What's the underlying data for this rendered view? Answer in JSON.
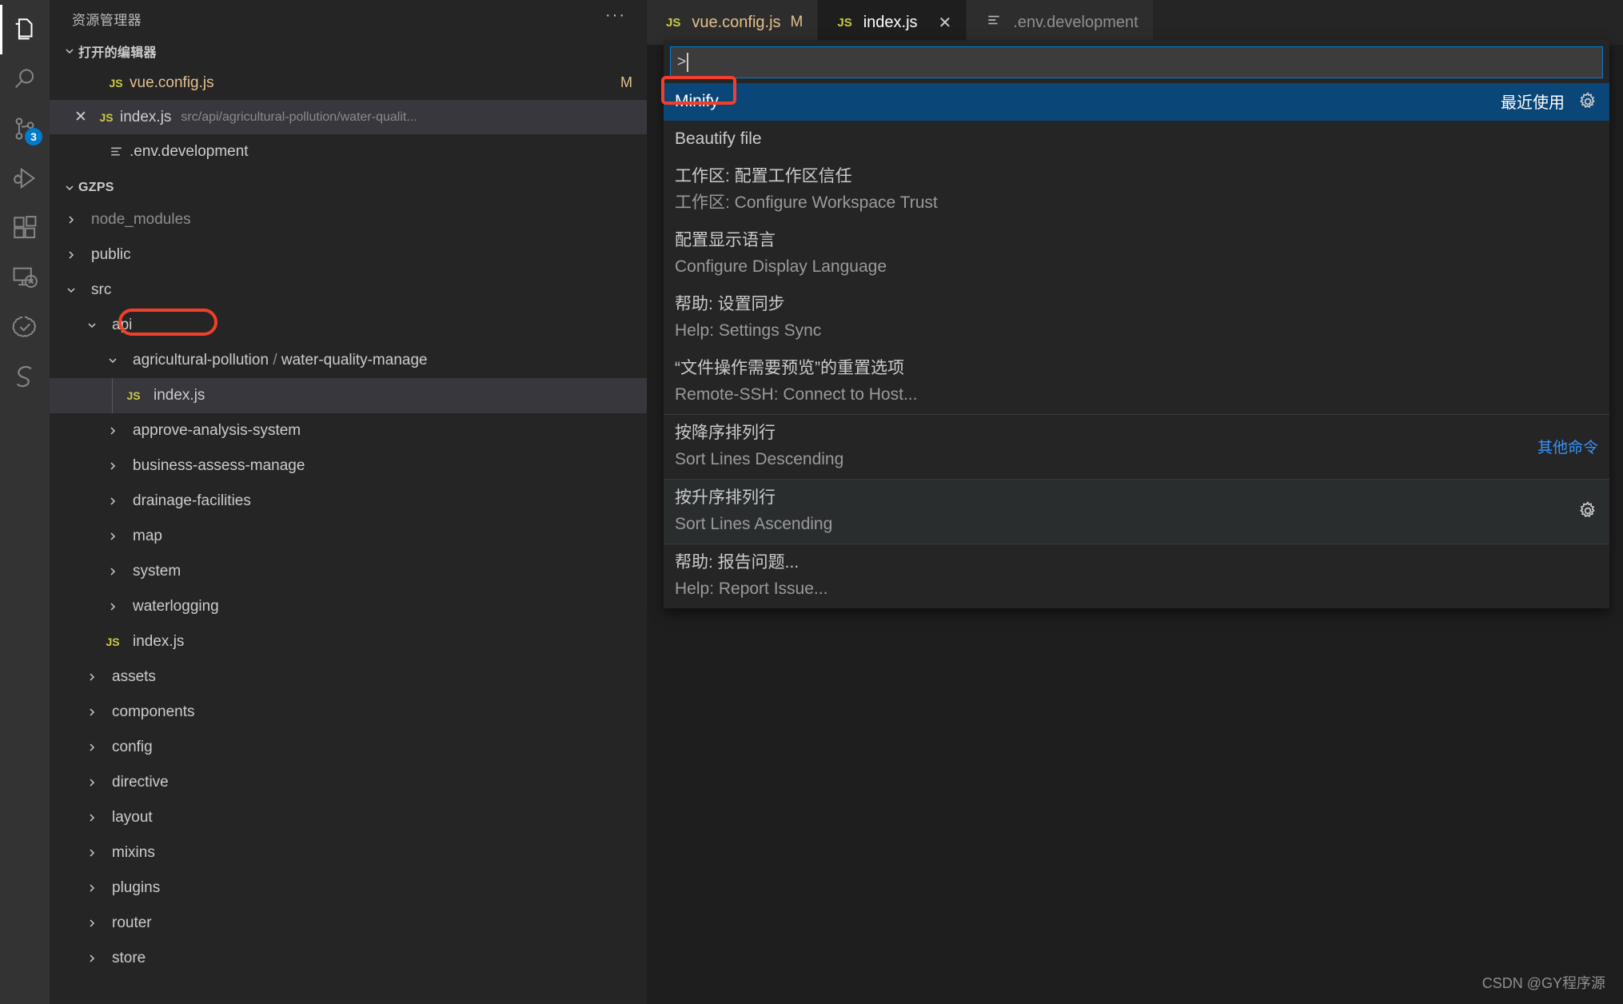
{
  "colors": {
    "activity_bar_bg": "#333333",
    "sidebar_bg": "#252526",
    "editor_bg": "#1e1e1e",
    "tab_active_bg": "#1e1e1e",
    "tab_inactive_bg": "#2d2d2d",
    "selected_row_bg": "#0b4678",
    "hover_row_bg": "#2a2d2e",
    "focus_border": "#007fd4",
    "badge_blue": "#007acc",
    "annotation_red": "#f0402a",
    "group_label_blue": "#3794ff",
    "modified_orange": "#e2c08d",
    "js_icon_yellow": "#cbcb41"
  },
  "activity_bar": {
    "items": [
      {
        "name": "explorer",
        "icon": "files-icon",
        "active": true,
        "badge": ""
      },
      {
        "name": "search",
        "icon": "search-icon",
        "active": false,
        "badge": ""
      },
      {
        "name": "source-control",
        "icon": "source-control-icon",
        "active": false,
        "badge": "3"
      },
      {
        "name": "run-and-debug",
        "icon": "run-debug-icon",
        "active": false,
        "badge": ""
      },
      {
        "name": "extensions",
        "icon": "extensions-icon",
        "active": false,
        "badge": ""
      },
      {
        "name": "remote-explorer",
        "icon": "remote-explorer-icon",
        "active": false,
        "badge": ""
      },
      {
        "name": "testing",
        "icon": "check-cloud-icon",
        "active": false,
        "badge": ""
      },
      {
        "name": "settings-sync",
        "icon": "s-logo-icon",
        "active": false,
        "badge": ""
      }
    ]
  },
  "sidebar": {
    "title": "资源管理器",
    "actions_label": "···",
    "open_editors": {
      "header": "打开的编辑器",
      "items": [
        {
          "icon": "js",
          "name": "vue.config.js",
          "path": "",
          "modified_badge": "M",
          "close_visible": false,
          "selected": false
        },
        {
          "icon": "js",
          "name": "index.js",
          "path": "src/api/agricultural-pollution/water-qualit...",
          "modified_badge": "",
          "close_visible": true,
          "selected": true
        },
        {
          "icon": "cfg",
          "name": ".env.development",
          "path": "",
          "modified_badge": "",
          "close_visible": false,
          "selected": false
        }
      ]
    },
    "project": {
      "header": "GZPS",
      "tree": [
        {
          "label": "node_modules",
          "type": "folder",
          "expanded": false,
          "depth": 1,
          "dimmed": true
        },
        {
          "label": "public",
          "type": "folder",
          "expanded": false,
          "depth": 1,
          "dimmed": false
        },
        {
          "label": "src",
          "type": "folder",
          "expanded": true,
          "depth": 1,
          "dimmed": false
        },
        {
          "label": "api",
          "type": "folder",
          "expanded": true,
          "depth": 2,
          "dimmed": false
        },
        {
          "label": "agricultural-pollution / water-quality-manage",
          "type": "folder",
          "expanded": true,
          "depth": 3,
          "dimmed": false
        },
        {
          "label": "index.js",
          "type": "file-js",
          "expanded": false,
          "depth": 4,
          "dimmed": false,
          "selected": true
        },
        {
          "label": "approve-analysis-system",
          "type": "folder",
          "expanded": false,
          "depth": 3,
          "dimmed": false
        },
        {
          "label": "business-assess-manage",
          "type": "folder",
          "expanded": false,
          "depth": 3,
          "dimmed": false
        },
        {
          "label": "drainage-facilities",
          "type": "folder",
          "expanded": false,
          "depth": 3,
          "dimmed": false
        },
        {
          "label": "map",
          "type": "folder",
          "expanded": false,
          "depth": 3,
          "dimmed": false
        },
        {
          "label": "system",
          "type": "folder",
          "expanded": false,
          "depth": 3,
          "dimmed": false
        },
        {
          "label": "waterlogging",
          "type": "folder",
          "expanded": false,
          "depth": 3,
          "dimmed": false
        },
        {
          "label": "index.js",
          "type": "file-js",
          "expanded": false,
          "depth": 3,
          "dimmed": false
        },
        {
          "label": "assets",
          "type": "folder",
          "expanded": false,
          "depth": 2,
          "dimmed": false
        },
        {
          "label": "components",
          "type": "folder",
          "expanded": false,
          "depth": 2,
          "dimmed": false
        },
        {
          "label": "config",
          "type": "folder",
          "expanded": false,
          "depth": 2,
          "dimmed": false
        },
        {
          "label": "directive",
          "type": "folder",
          "expanded": false,
          "depth": 2,
          "dimmed": false
        },
        {
          "label": "layout",
          "type": "folder",
          "expanded": false,
          "depth": 2,
          "dimmed": false
        },
        {
          "label": "mixins",
          "type": "folder",
          "expanded": false,
          "depth": 2,
          "dimmed": false
        },
        {
          "label": "plugins",
          "type": "folder",
          "expanded": false,
          "depth": 2,
          "dimmed": false
        },
        {
          "label": "router",
          "type": "folder",
          "expanded": false,
          "depth": 2,
          "dimmed": false
        },
        {
          "label": "store",
          "type": "folder",
          "expanded": false,
          "depth": 2,
          "dimmed": false
        }
      ]
    }
  },
  "tabs": [
    {
      "icon": "js",
      "label": "vue.config.js",
      "dirty_mark": "M",
      "active": false,
      "close_visible": false
    },
    {
      "icon": "js",
      "label": "index.js",
      "dirty_mark": "",
      "active": true,
      "close_visible": true,
      "close_glyph": "✕"
    },
    {
      "icon": "cfg",
      "label": ".env.development",
      "dirty_mark": "",
      "active": false,
      "close_visible": false
    }
  ],
  "command_palette": {
    "input_value": ">",
    "placeholder": "",
    "items": [
      {
        "title": "Minify",
        "subtitle": "",
        "state": "selected",
        "right_label": "最近使用",
        "gear": true,
        "separator_above": false
      },
      {
        "title": "Beautify file",
        "subtitle": "",
        "state": "normal",
        "right_label": "",
        "gear": false,
        "separator_above": false
      },
      {
        "title": "工作区: 配置工作区信任",
        "subtitle": "工作区: Configure Workspace Trust",
        "state": "normal",
        "right_label": "",
        "gear": false,
        "separator_above": false
      },
      {
        "title": "配置显示语言",
        "subtitle": "Configure Display Language",
        "state": "normal",
        "right_label": "",
        "gear": false,
        "separator_above": false
      },
      {
        "title": "帮助: 设置同步",
        "subtitle": "Help: Settings Sync",
        "state": "normal",
        "right_label": "",
        "gear": false,
        "separator_above": false
      },
      {
        "title": "“文件操作需要预览”的重置选项",
        "subtitle": "Remote-SSH: Connect to Host...",
        "state": "normal",
        "right_label": "",
        "gear": false,
        "separator_above": false
      },
      {
        "title": "按降序排列行",
        "subtitle": "Sort Lines Descending",
        "state": "normal",
        "right_label": "其他命令",
        "gear": false,
        "separator_above": true
      },
      {
        "title": "按升序排列行",
        "subtitle": "Sort Lines Ascending",
        "state": "hovered",
        "right_label": "",
        "gear": true,
        "separator_above": true
      },
      {
        "title": "帮助: 报告问题...",
        "subtitle": "Help: Report Issue...",
        "state": "normal",
        "right_label": "",
        "gear": false,
        "separator_above": true
      }
    ]
  },
  "watermark": "CSDN @GY程序源"
}
